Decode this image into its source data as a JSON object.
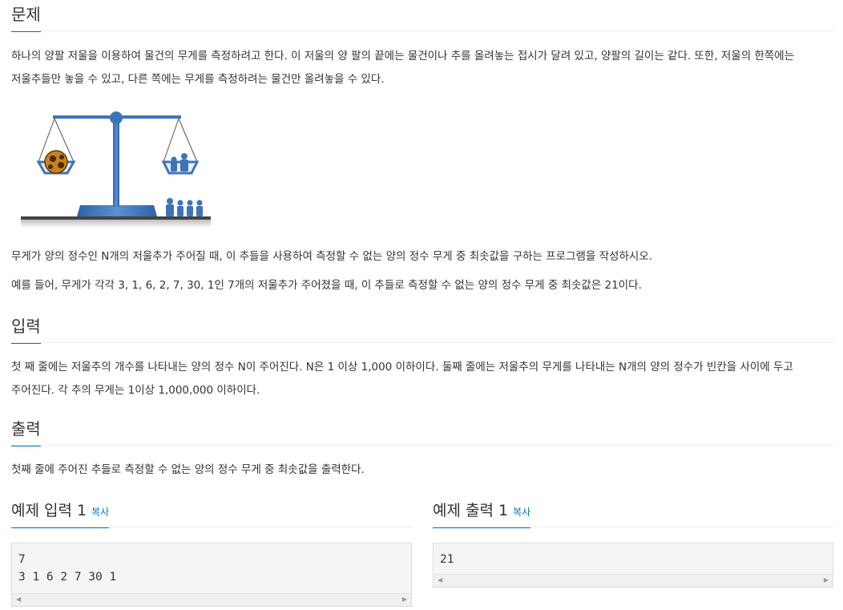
{
  "problem": {
    "heading": "문제",
    "paragraph1_line1": "하나의 양팔 저울을 이용하여 물건의 무게를 측정하려고 한다. 이 저울의 양 팔의 끝에는 물건이나 추를 올려놓는 접시가 달려 있고, 양팔의 길이는 같다. 또한, 저울의 한쪽에는",
    "paragraph1_line2": "저울추들만 놓을 수 있고, 다른 쪽에는 무게를 측정하려는 물건만 올려놓을 수 있다.",
    "paragraph2": "무게가 양의 정수인 N개의 저울추가 주어질 때, 이 추들을 사용하여 측정할 수 없는 양의 정수 무게 중 최솟값을 구하는 프로그램을 작성하시오.",
    "paragraph3": "예를 들어, 무게가 각각 3, 1, 6, 2, 7, 30, 1인 7개의 저울추가 주어졌을 때, 이 추들로 측정할 수 없는 양의 정수 무게 중 최솟값은 21이다."
  },
  "input": {
    "heading": "입력",
    "line1": "첫 째 줄에는 저울추의 개수를 나타내는 양의 정수 N이 주어진다. N은 1 이상 1,000 이하이다. 둘째 줄에는 저울추의 무게를 나타내는 N개의 양의 정수가 빈칸을 사이에 두고",
    "line2": "주어진다. 각 추의 무게는 1이상 1,000,000 이하이다."
  },
  "output": {
    "heading": "출력",
    "text": "첫째 줄에 주어진 추들로 측정할 수 없는 양의 정수 무게 중 최솟값을 출력한다."
  },
  "sample_input": {
    "heading": "예제 입력 1",
    "copy_label": "복사",
    "line1": "7",
    "line2": "3 1 6 2 7 30 1"
  },
  "sample_output": {
    "heading": "예제 출력 1",
    "copy_label": "복사",
    "line1": "21"
  },
  "colors": {
    "accent": "#0076c0",
    "scale_blue": "#3d74b8",
    "code_bg": "#f5f5f5"
  }
}
